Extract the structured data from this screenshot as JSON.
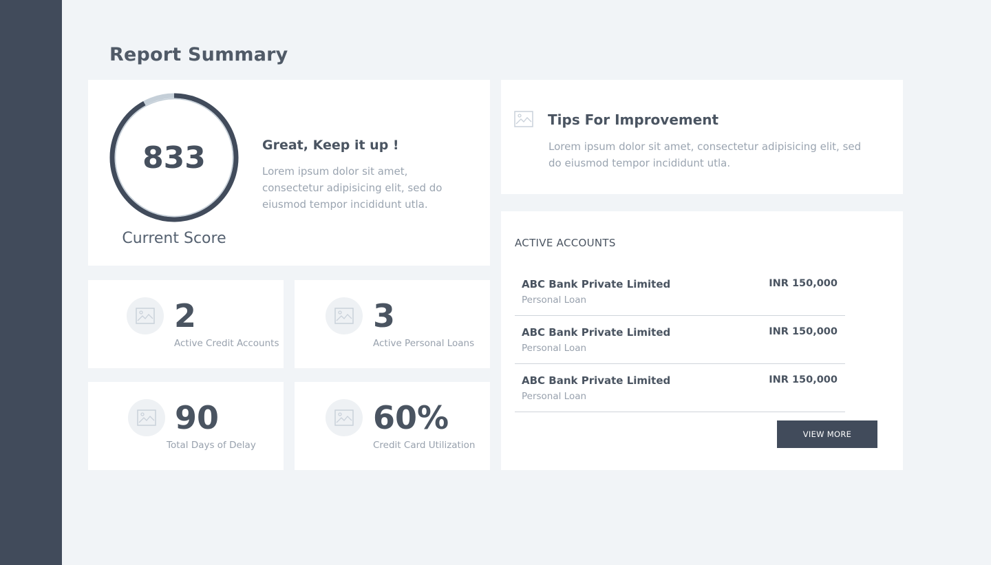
{
  "page": {
    "title": "Report Summary"
  },
  "score": {
    "value": "833",
    "label": "Current Score",
    "progress": 0.92,
    "feedback_title": "Great, Keep it up !",
    "feedback_text": "Lorem ipsum dolor sit amet, consectetur adipisicing elit, sed do eiusmod tempor incididunt utla.",
    "colors": {
      "track": "#c5cfd8",
      "fill": "#414b5b"
    }
  },
  "stats": [
    {
      "value": "2",
      "label": "Active Credit Accounts",
      "icon": "image-icon"
    },
    {
      "value": "3",
      "label": "Active Personal Loans",
      "icon": "image-icon"
    },
    {
      "value": "90",
      "label": "Total Days of Delay",
      "icon": "image-icon"
    },
    {
      "value": "60%",
      "label": "Credit Card Utilization",
      "icon": "image-icon"
    }
  ],
  "tips": {
    "icon": "image-icon",
    "title": "Tips For Improvement",
    "text": "Lorem ipsum dolor sit amet, consectetur adipisicing elit, sed do eiusmod tempor incididunt utla."
  },
  "accounts": {
    "title": "ACTIVE ACCOUNTS",
    "items": [
      {
        "name": "ABC Bank Private Limited",
        "type": "Personal Loan",
        "amount": "INR 150,000"
      },
      {
        "name": "ABC Bank Private Limited",
        "type": "Personal Loan",
        "amount": "INR 150,000"
      },
      {
        "name": "ABC Bank Private Limited",
        "type": "Personal Loan",
        "amount": "INR 150,000"
      }
    ],
    "view_more_label": "VIEW MORE"
  },
  "colors": {
    "sidebar": "#414b5b",
    "background": "#f1f4f7",
    "card": "#ffffff",
    "text_dark": "#4a5461",
    "text_muted": "#98a1ad",
    "button": "#414b5b"
  }
}
